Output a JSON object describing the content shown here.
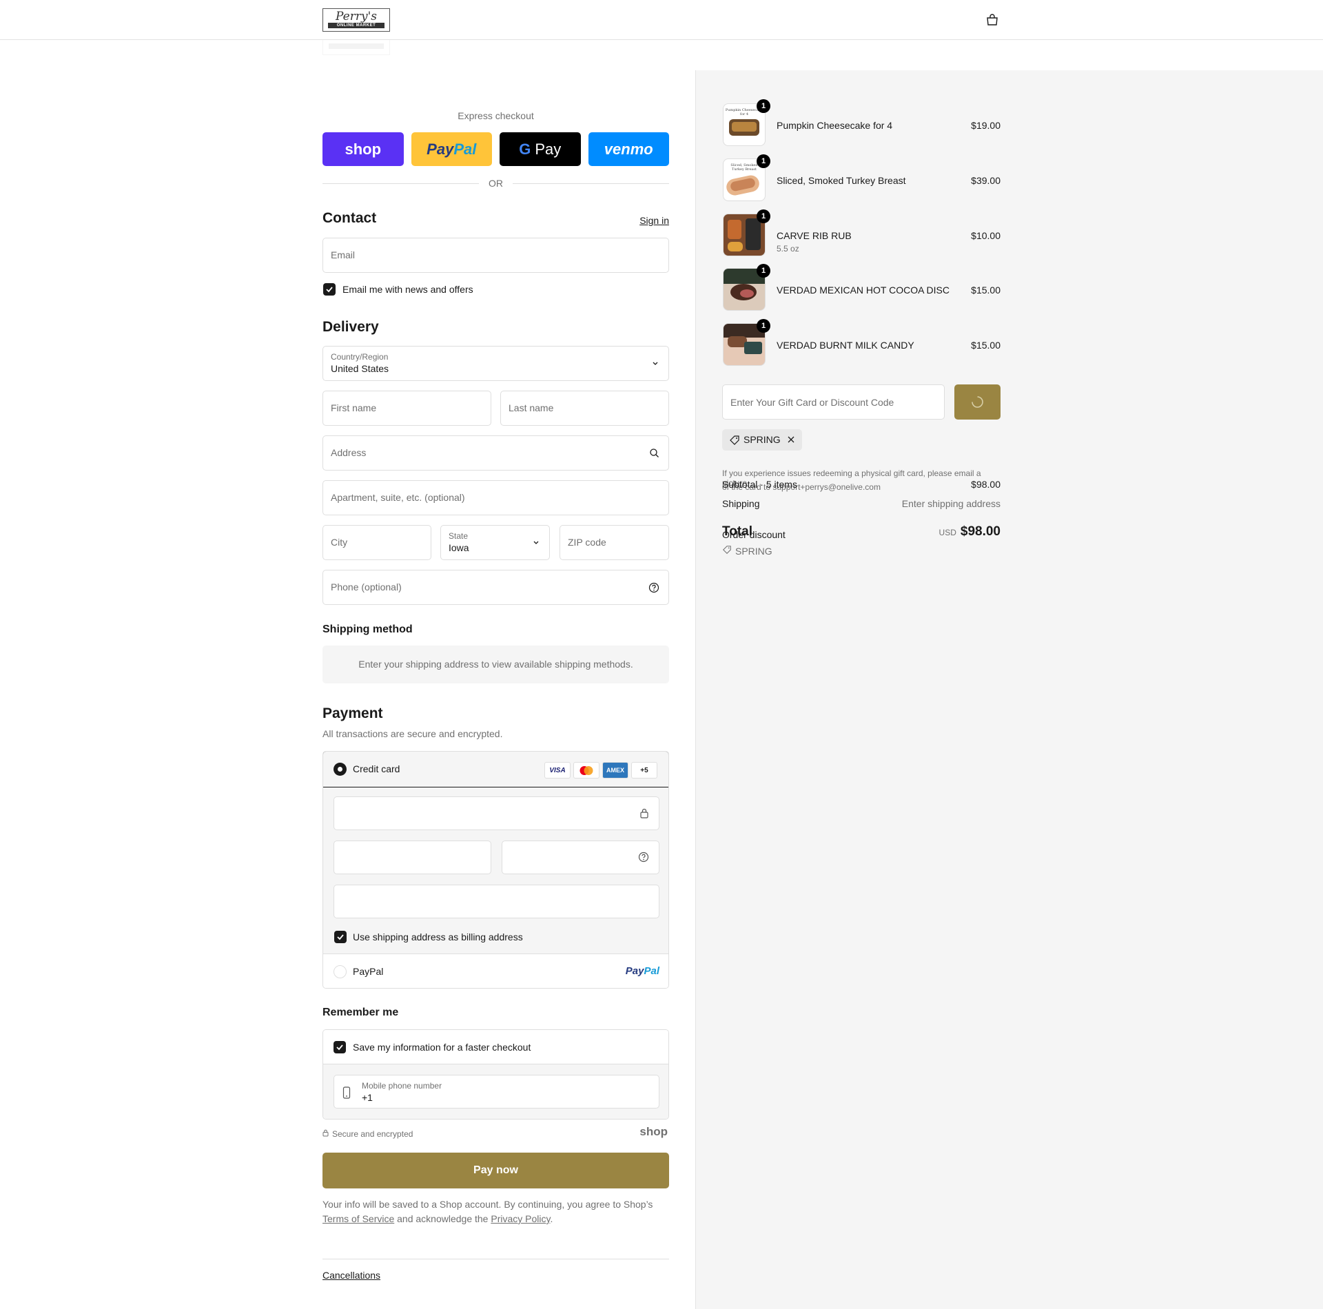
{
  "header": {
    "logo_script": "Perry's",
    "logo_band": "ONLINE MARKET",
    "bag_icon": "shopping-bag-icon"
  },
  "express": {
    "title": "Express checkout",
    "shop_label": "shop",
    "paypal_part1": "Pay",
    "paypal_part2": "Pal",
    "gpay_g": "G",
    "gpay_label": "Pay",
    "venmo_label": "venmo",
    "or_label": "OR"
  },
  "contact": {
    "title": "Contact",
    "signin_label": "Sign in",
    "email_placeholder": "Email",
    "newsletter_label": "Email me with news and offers"
  },
  "delivery": {
    "title": "Delivery",
    "country_label": "Country/Region",
    "country_value": "United States",
    "first_name_placeholder": "First name",
    "last_name_placeholder": "Last name",
    "address_placeholder": "Address",
    "apartment_placeholder": "Apartment, suite, etc. (optional)",
    "city_placeholder": "City",
    "state_label": "State",
    "state_value": "Iowa",
    "zip_placeholder": "ZIP code",
    "phone_placeholder": "Phone (optional)"
  },
  "shipping_method": {
    "title": "Shipping method",
    "message": "Enter your shipping address to view available shipping methods."
  },
  "payment": {
    "title": "Payment",
    "subtitle": "All transactions are secure and encrypted.",
    "credit_card_label": "Credit card",
    "card_brands": [
      "VISA",
      "Mastercard",
      "AMEX"
    ],
    "more_brands": "+5",
    "billing_label": "Use shipping address as billing address",
    "paypal_option_label": "PayPal",
    "paypal_logo_1": "Pay",
    "paypal_logo_2": "Pal"
  },
  "remember": {
    "title": "Remember me",
    "save_label": "Save my information for a faster checkout",
    "mobile_label": "Mobile phone number",
    "mobile_value": "+1",
    "secure_label": "Secure and encrypted",
    "shop_logo": "shop"
  },
  "pay_now_label": "Pay now",
  "legal": {
    "text1": "Your info will be saved to a Shop account. By continuing, you agree to Shop’s",
    "terms": "Terms of Service",
    "text2": "and acknowledge the",
    "privacy": "Privacy Policy",
    "text3": "."
  },
  "footer": {
    "cancellations": "Cancellations"
  },
  "cart": {
    "items": [
      {
        "name": "Pumpkin Cheesecake for 4",
        "variant": "",
        "price": "$19.00",
        "qty": "1"
      },
      {
        "name": "Sliced, Smoked Turkey Breast",
        "variant": "",
        "price": "$39.00",
        "qty": "1"
      },
      {
        "name": "CARVE RIB RUB",
        "variant": "5.5 oz",
        "price": "$10.00",
        "qty": "1"
      },
      {
        "name": "VERDAD MEXICAN HOT COCOA DISC",
        "variant": "",
        "price": "$15.00",
        "qty": "1"
      },
      {
        "name": "VERDAD BURNT MILK CANDY",
        "variant": "",
        "price": "$15.00",
        "qty": "1"
      }
    ],
    "thumb_texts": [
      "Pumpkin Cheesecake for 4",
      "Sliced, Smoked Turkey Breast"
    ]
  },
  "discount": {
    "placeholder": "Enter Your Gift Card or Discount Code",
    "applied_code": "SPRING",
    "note_line1": "If you experience issues redeeming a physical gift card, please email a picture",
    "note_line2": "of the card to support+perrys@onelive.com"
  },
  "summary": {
    "subtotal_label": "Subtotal · 5 items",
    "subtotal_value": "$98.00",
    "shipping_label": "Shipping",
    "shipping_value": "Enter shipping address",
    "order_discount_label": "Order discount",
    "discount_code": "SPRING",
    "total_label": "Total",
    "currency": "USD",
    "total_value": "$98.00"
  },
  "colors": {
    "accent": "#9a8542",
    "shop_purple": "#5a31f4",
    "paypal_yellow": "#ffc439",
    "venmo_blue": "#008cff",
    "summary_bg": "#f5f5f5"
  }
}
